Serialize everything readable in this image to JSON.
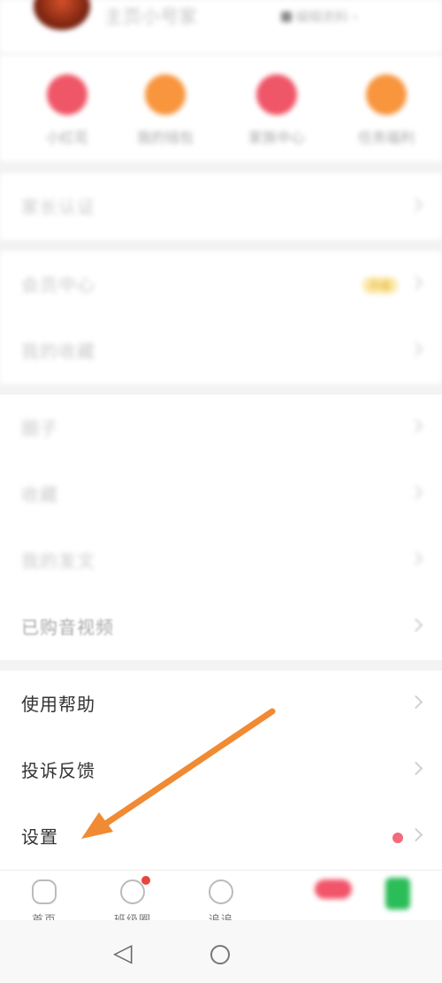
{
  "header": {
    "name": "主页小号家",
    "right_text": "编辑资料 ›"
  },
  "quick_actions": [
    {
      "label": "小红花",
      "color": "#ef5667"
    },
    {
      "label": "我的钱包",
      "color": "#f8953d"
    },
    {
      "label": "家族中心",
      "color": "#ef5667"
    },
    {
      "label": "任务福利",
      "color": "#f8953d"
    }
  ],
  "groups": [
    {
      "items": [
        {
          "label": "家长认证"
        }
      ]
    },
    {
      "items": [
        {
          "label": "会员中心",
          "badge": "升级"
        },
        {
          "label": "我的收藏"
        }
      ]
    },
    {
      "items": [
        {
          "label": "圈子"
        },
        {
          "label": "收藏"
        },
        {
          "label": "我的发文"
        },
        {
          "label": "已购音视频"
        }
      ]
    },
    {
      "items": [
        {
          "label": "使用帮助"
        },
        {
          "label": "投诉反馈"
        },
        {
          "label": "设置"
        }
      ]
    }
  ],
  "tabbar": [
    {
      "label": "首页"
    },
    {
      "label": "班级圈"
    },
    {
      "label": "追追"
    }
  ],
  "colors": {
    "arrow": "#f08a33",
    "notify": "#e8453c"
  }
}
